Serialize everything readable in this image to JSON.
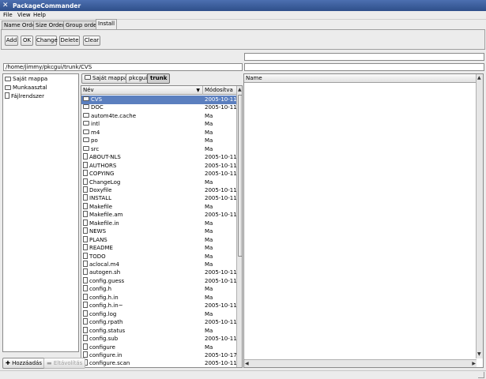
{
  "window": {
    "title": "PackageCommander"
  },
  "menu": [
    "File",
    "View",
    "Help"
  ],
  "tabs": [
    {
      "label": "Name Order"
    },
    {
      "label": "Size Order"
    },
    {
      "label": "Group order"
    },
    {
      "label": "Install",
      "active": true
    }
  ],
  "toolbar": {
    "add": "Add",
    "ok": "OK",
    "change": "Change",
    "delete": "Delete",
    "clear": "Clear"
  },
  "path_field": "/home/jimmy/pkcgui/trunk/CVS",
  "places": [
    {
      "label": "Saját mappa",
      "icon": "home-folder-icon"
    },
    {
      "label": "Munkaasztal",
      "icon": "desktop-icon"
    },
    {
      "label": "Fájlrendszer",
      "icon": "filesystem-icon"
    }
  ],
  "path_bar": {
    "home": "Saját mappa",
    "segments": [
      "pkcgui",
      "trunk"
    ],
    "active": "trunk"
  },
  "file_list": {
    "columns": {
      "name": "Név",
      "modified": "Módosítva"
    },
    "rows": [
      {
        "name": "CVS",
        "modified": "2005-10-11",
        "type": "folder",
        "selected": true
      },
      {
        "name": "DOC",
        "modified": "2005-10-11",
        "type": "folder"
      },
      {
        "name": "autom4te.cache",
        "modified": "Ma",
        "type": "folder"
      },
      {
        "name": "intl",
        "modified": "Ma",
        "type": "folder"
      },
      {
        "name": "m4",
        "modified": "Ma",
        "type": "folder"
      },
      {
        "name": "po",
        "modified": "Ma",
        "type": "folder"
      },
      {
        "name": "src",
        "modified": "Ma",
        "type": "folder"
      },
      {
        "name": "ABOUT-NLS",
        "modified": "2005-10-11",
        "type": "file"
      },
      {
        "name": "AUTHORS",
        "modified": "2005-10-11",
        "type": "file"
      },
      {
        "name": "COPYING",
        "modified": "2005-10-11",
        "type": "file"
      },
      {
        "name": "ChangeLog",
        "modified": "Ma",
        "type": "file"
      },
      {
        "name": "Doxyfile",
        "modified": "2005-10-11",
        "type": "file"
      },
      {
        "name": "INSTALL",
        "modified": "2005-10-11",
        "type": "file"
      },
      {
        "name": "Makefile",
        "modified": "Ma",
        "type": "file"
      },
      {
        "name": "Makefile.am",
        "modified": "2005-10-11",
        "type": "file"
      },
      {
        "name": "Makefile.in",
        "modified": "Ma",
        "type": "file"
      },
      {
        "name": "NEWS",
        "modified": "Ma",
        "type": "file"
      },
      {
        "name": "PLANS",
        "modified": "Ma",
        "type": "file"
      },
      {
        "name": "README",
        "modified": "Ma",
        "type": "file"
      },
      {
        "name": "TODO",
        "modified": "Ma",
        "type": "file"
      },
      {
        "name": "aclocal.m4",
        "modified": "Ma",
        "type": "file"
      },
      {
        "name": "autogen.sh",
        "modified": "2005-10-11",
        "type": "file"
      },
      {
        "name": "config.guess",
        "modified": "2005-10-11",
        "type": "file"
      },
      {
        "name": "config.h",
        "modified": "Ma",
        "type": "file"
      },
      {
        "name": "config.h.in",
        "modified": "Ma",
        "type": "file"
      },
      {
        "name": "config.h.in~",
        "modified": "2005-10-11",
        "type": "file"
      },
      {
        "name": "config.log",
        "modified": "Ma",
        "type": "file"
      },
      {
        "name": "config.rpath",
        "modified": "2005-10-11",
        "type": "file"
      },
      {
        "name": "config.status",
        "modified": "Ma",
        "type": "file"
      },
      {
        "name": "config.sub",
        "modified": "2005-10-11",
        "type": "file"
      },
      {
        "name": "configure",
        "modified": "Ma",
        "type": "file"
      },
      {
        "name": "configure.in",
        "modified": "2005-10-17",
        "type": "file"
      },
      {
        "name": "configure.scan",
        "modified": "2005-10-11",
        "type": "file"
      }
    ]
  },
  "name_panel": {
    "column": "Name"
  },
  "bottom_buttons": {
    "add": "Hozzáadás",
    "remove": "Eltávolítás"
  },
  "colors": {
    "title_bar": "#2f4f8a",
    "selection": "#5b7fbf",
    "background": "#ececec"
  }
}
